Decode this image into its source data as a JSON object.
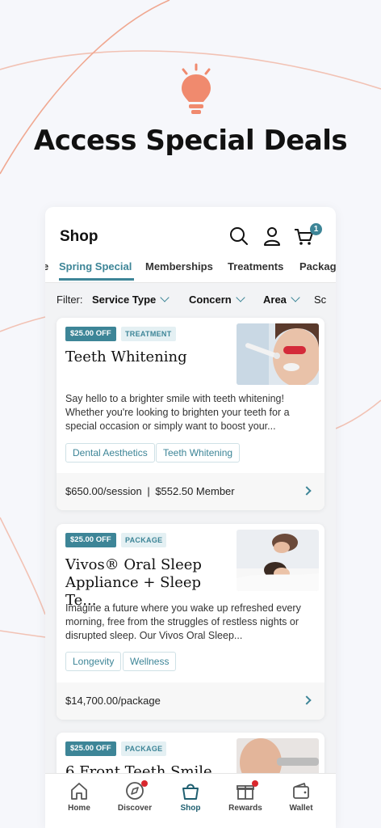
{
  "headline": "Access Special Deals",
  "colors": {
    "accent": "#3d8597",
    "bulb": "#f08a6e",
    "arc": "#f2b8a7"
  },
  "header": {
    "title": "Shop",
    "cart_count": "1"
  },
  "tabs": [
    {
      "label": "e",
      "active": false
    },
    {
      "label": "Spring Special",
      "active": true
    },
    {
      "label": "Memberships",
      "active": false
    },
    {
      "label": "Treatments",
      "active": false
    },
    {
      "label": "Packag",
      "active": false
    }
  ],
  "filter": {
    "label": "Filter:",
    "chips": [
      "Service Type",
      "Concern",
      "Area",
      "Sc"
    ]
  },
  "cards": [
    {
      "discount": "$25.00 OFF",
      "type": "TREATMENT",
      "title": "Teeth Whitening",
      "description": "Say hello to a brighter smile with teeth whitening! Whether you're looking to brighten your teeth for a special occasion or simply want to boost your...",
      "tags": [
        "Dental Aesthetics",
        "Teeth Whitening"
      ],
      "price": "$650.00/session",
      "member_price": "$552.50 Member"
    },
    {
      "discount": "$25.00 OFF",
      "type": "PACKAGE",
      "title": "Vivos® Oral Sleep Appliance + Sleep Te...",
      "description": "Imagine a future where you wake up refreshed every morning, free from the struggles of restless nights or disrupted sleep. Our Vivos Oral Sleep...",
      "tags": [
        "Longevity",
        "Wellness"
      ],
      "price": "$14,700.00/package"
    },
    {
      "discount": "$25.00 OFF",
      "type": "PACKAGE",
      "title": "6 Front Teeth Smile"
    }
  ],
  "nav": [
    {
      "label": "Home",
      "icon": "home-icon"
    },
    {
      "label": "Discover",
      "icon": "compass-icon"
    },
    {
      "label": "Shop",
      "icon": "shopping-bag-icon"
    },
    {
      "label": "Rewards",
      "icon": "gift-icon"
    },
    {
      "label": "Wallet",
      "icon": "wallet-icon"
    }
  ]
}
